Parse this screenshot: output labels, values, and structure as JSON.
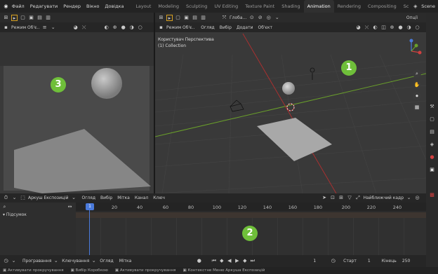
{
  "topbar": {
    "menus": [
      "Файл",
      "Редагувати",
      "Рендер",
      "Вікно",
      "Довідка"
    ],
    "workspaces": [
      "Layout",
      "Modeling",
      "Sculpting",
      "UV Editing",
      "Texture Paint",
      "Shading",
      "Animation",
      "Rendering",
      "Compositing",
      "Sc"
    ],
    "active_workspace": "Animation",
    "scene_label": "Scene"
  },
  "left_viewport": {
    "mode_label": "Режим Об'є..",
    "badge": "3"
  },
  "main_viewport": {
    "orient_label": "Глоба...",
    "options_label": "Опції",
    "mode_label": "Режим Об'є..",
    "menus": [
      "Огляд",
      "Вибір",
      "Додати",
      "Об'єкт"
    ],
    "overlay_title": "Користувач Перспектива",
    "overlay_collection": "(1) Collection",
    "badge": "1"
  },
  "dopesheet": {
    "mode_label": "Аркуш Експозицій",
    "menus": [
      "Огляд",
      "Вибір",
      "Мітка",
      "Канал",
      "Ключ"
    ],
    "snap_label": "Найближчий кадр",
    "summary_label": "Підсумок",
    "current_frame_marker": "1",
    "ticks": [
      "20",
      "40",
      "60",
      "80",
      "100",
      "120",
      "140",
      "160",
      "180",
      "200",
      "220",
      "240"
    ],
    "badge": "2"
  },
  "playback": {
    "menus": [
      "Програвання",
      "Ключування",
      "Огляд",
      "Мітка"
    ],
    "current_frame": "1",
    "start_label": "Старт",
    "start_value": "1",
    "end_label": "Кінець",
    "end_value": "250"
  },
  "statusbar": {
    "items": [
      "Активувати прокручування",
      "Вибір Коробкою",
      "Активувати прокручування",
      "Контекстне Меню Аркуша Експозицій"
    ]
  }
}
